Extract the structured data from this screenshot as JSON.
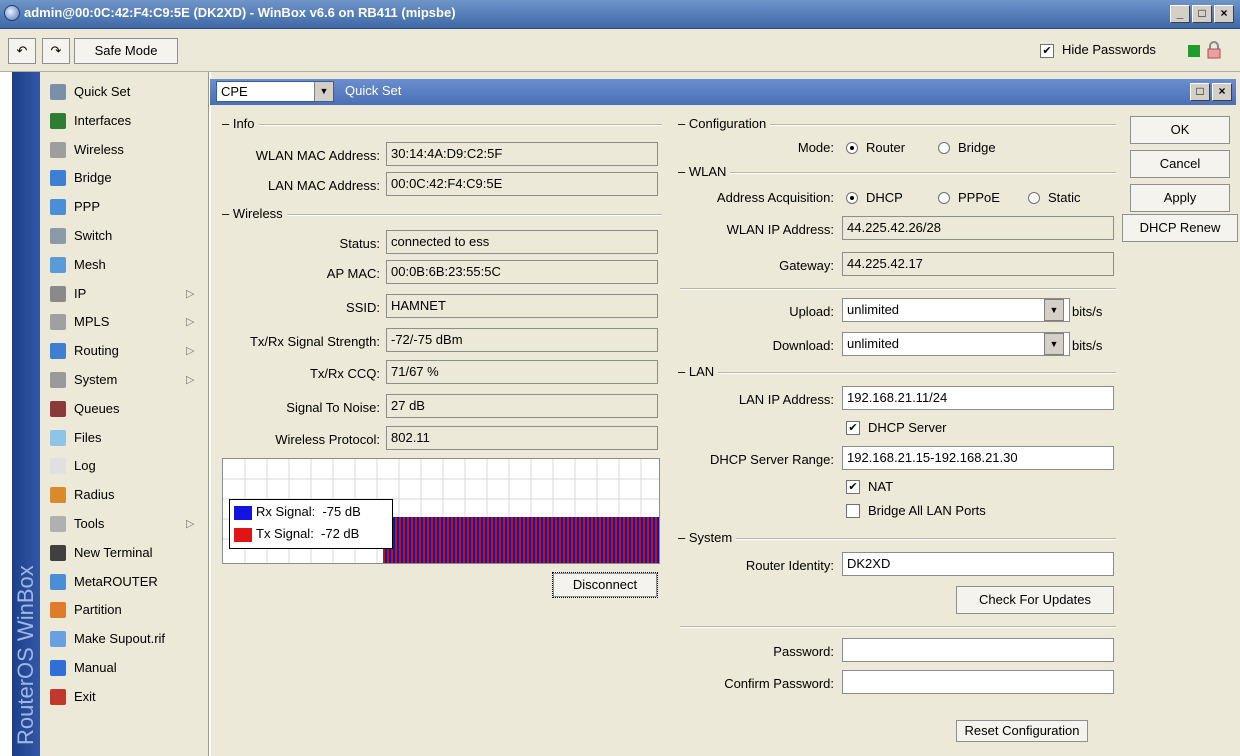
{
  "window": {
    "title": "admin@00:0C:42:F4:C9:5E (DK2XD) - WinBox v6.6 on RB411 (mipsbe)",
    "min_glyph": "_",
    "max_glyph": "□",
    "close_glyph": "×"
  },
  "toolbar": {
    "undo_icon": "↶",
    "redo_icon": "↷",
    "safe_mode": "Safe Mode",
    "hide_passwords": "Hide Passwords",
    "hide_passwords_checked": "✔"
  },
  "brand": "RouterOS WinBox",
  "sidebar": {
    "items": [
      {
        "label": "Quick Set",
        "icon": "quick-set-icon",
        "color": "#7a8fa8"
      },
      {
        "label": "Interfaces",
        "icon": "interfaces-icon",
        "color": "#2e7d32"
      },
      {
        "label": "Wireless",
        "icon": "wireless-icon",
        "color": "#9e9e9e"
      },
      {
        "label": "Bridge",
        "icon": "bridge-icon",
        "color": "#3f7fd1"
      },
      {
        "label": "PPP",
        "icon": "ppp-icon",
        "color": "#4a8fd6"
      },
      {
        "label": "Switch",
        "icon": "switch-icon",
        "color": "#8c9aa8"
      },
      {
        "label": "Mesh",
        "icon": "mesh-icon",
        "color": "#5a9ad6"
      },
      {
        "label": "IP",
        "icon": "ip-icon",
        "color": "#8a8a8a",
        "arrow": "▷"
      },
      {
        "label": "MPLS",
        "icon": "mpls-icon",
        "color": "#a0a0a0",
        "arrow": "▷"
      },
      {
        "label": "Routing",
        "icon": "routing-icon",
        "color": "#3f7fd1",
        "arrow": "▷"
      },
      {
        "label": "System",
        "icon": "system-icon",
        "color": "#9a9a9a",
        "arrow": "▷"
      },
      {
        "label": "Queues",
        "icon": "queues-icon",
        "color": "#8b3a3a"
      },
      {
        "label": "Files",
        "icon": "files-icon",
        "color": "#8fc3e8"
      },
      {
        "label": "Log",
        "icon": "log-icon",
        "color": "#e0e0e0"
      },
      {
        "label": "Radius",
        "icon": "radius-icon",
        "color": "#d98b2b"
      },
      {
        "label": "Tools",
        "icon": "tools-icon",
        "color": "#b0b0b0",
        "arrow": "▷"
      },
      {
        "label": "New Terminal",
        "icon": "terminal-icon",
        "color": "#404040"
      },
      {
        "label": "MetaROUTER",
        "icon": "metarouter-icon",
        "color": "#4a8fd6"
      },
      {
        "label": "Partition",
        "icon": "partition-icon",
        "color": "#e07b2b"
      },
      {
        "label": "Make Supout.rif",
        "icon": "supout-icon",
        "color": "#6aa0e0"
      },
      {
        "label": "Manual",
        "icon": "manual-icon",
        "color": "#2f6fd6"
      },
      {
        "label": "Exit",
        "icon": "exit-icon",
        "color": "#c0392b"
      }
    ]
  },
  "quickset": {
    "mode_select": "CPE",
    "title": "Quick Set",
    "dropdown_glyph": "▼",
    "info": {
      "section": "Info",
      "wlan_mac_label": "WLAN MAC Address:",
      "wlan_mac": "30:14:4A:D9:C2:5F",
      "lan_mac_label": "LAN MAC Address:",
      "lan_mac": "00:0C:42:F4:C9:5E"
    },
    "wireless": {
      "section": "Wireless",
      "status_label": "Status:",
      "status": "connected to ess",
      "ap_mac_label": "AP MAC:",
      "ap_mac": "00:0B:6B:23:55:5C",
      "ssid_label": "SSID:",
      "ssid": "HAMNET",
      "signal_label": "Tx/Rx Signal Strength:",
      "signal": "-72/-75 dBm",
      "ccq_label": "Tx/Rx CCQ:",
      "ccq": "71/67 %",
      "snr_label": "Signal To Noise:",
      "snr": "27 dB",
      "protocol_label": "Wireless Protocol:",
      "protocol": "802.11"
    },
    "legend": {
      "rx": "Rx Signal:  -75 dB",
      "tx": "Tx Signal:  -72 dB",
      "rx_color": "#1414e0",
      "tx_color": "#e01414"
    },
    "disconnect": "Disconnect",
    "configuration": {
      "section": "Configuration",
      "mode_label": "Mode:",
      "mode_router": "Router",
      "mode_bridge": "Bridge"
    },
    "wlan": {
      "section": "WLAN",
      "acq_label": "Address Acquisition:",
      "acq_dhcp": "DHCP",
      "acq_pppoe": "PPPoE",
      "acq_static": "Static",
      "ip_label": "WLAN IP Address:",
      "ip": "44.225.42.26/28",
      "gw_label": "Gateway:",
      "gw": "44.225.42.17",
      "upload_label": "Upload:",
      "upload": "unlimited",
      "download_label": "Download:",
      "download": "unlimited",
      "unit": "bits/s"
    },
    "lan": {
      "section": "LAN",
      "ip_label": "LAN IP Address:",
      "ip": "192.168.21.11/24",
      "dhcp_server": "DHCP Server",
      "range_label": "DHCP Server Range:",
      "range": "192.168.21.15-192.168.21.30",
      "nat": "NAT",
      "bridge_all": "Bridge All LAN Ports",
      "check": "✔"
    },
    "system": {
      "section": "System",
      "identity_label": "Router Identity:",
      "identity": "DK2XD",
      "check_updates": "Check For Updates",
      "password_label": "Password:",
      "confirm_label": "Confirm Password:",
      "reset": "Reset Configuration"
    },
    "buttons": {
      "ok": "OK",
      "cancel": "Cancel",
      "apply": "Apply",
      "dhcp_renew": "DHCP Renew"
    }
  }
}
